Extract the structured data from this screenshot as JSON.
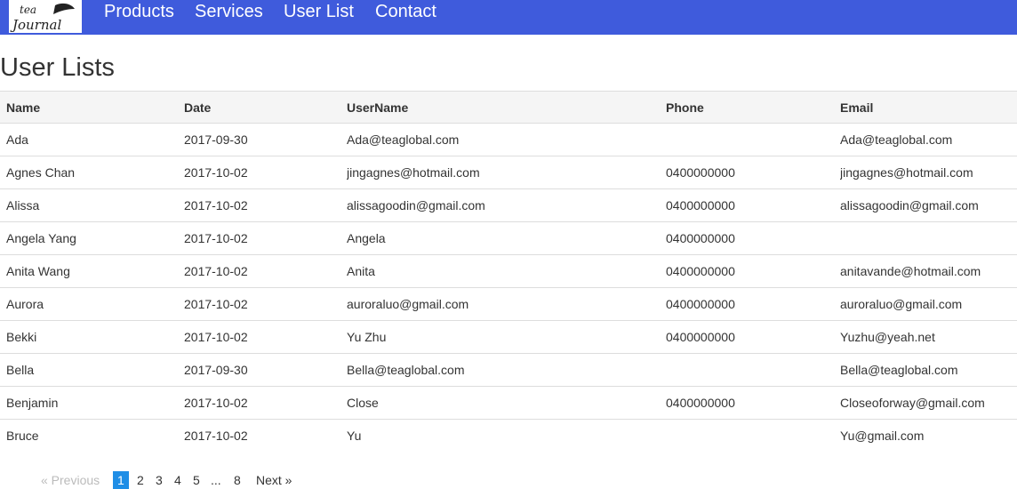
{
  "navbar": {
    "brand": "tea Journal",
    "links": [
      "Products",
      "Services",
      "User List",
      "Contact"
    ]
  },
  "page": {
    "title": "User Lists"
  },
  "table": {
    "headers": [
      "Name",
      "Date",
      "UserName",
      "Phone",
      "Email"
    ],
    "rows": [
      [
        "Ada",
        "2017-09-30",
        "Ada@teaglobal.com",
        "",
        "Ada@teaglobal.com"
      ],
      [
        "Agnes Chan",
        "2017-10-02",
        "jingagnes@hotmail.com",
        "0400000000",
        "jingagnes@hotmail.com"
      ],
      [
        "Alissa",
        "2017-10-02",
        "alissagoodin@gmail.com",
        "0400000000",
        "alissagoodin@gmail.com"
      ],
      [
        "Angela Yang",
        "2017-10-02",
        "Angela",
        "0400000000",
        ""
      ],
      [
        "Anita Wang",
        "2017-10-02",
        "Anita",
        "0400000000",
        "anitavande@hotmail.com"
      ],
      [
        "Aurora",
        "2017-10-02",
        "auroraluo@gmail.com",
        "0400000000",
        "auroraluo@gmail.com"
      ],
      [
        "Bekki",
        "2017-10-02",
        "Yu Zhu",
        "0400000000",
        "Yuzhu@yeah.net"
      ],
      [
        "Bella",
        "2017-09-30",
        "Bella@teaglobal.com",
        "",
        "Bella@teaglobal.com"
      ],
      [
        "Benjamin",
        "2017-10-02",
        "Close",
        "0400000000",
        "Closeoforway@gmail.com"
      ],
      [
        "Bruce",
        "2017-10-02",
        "Yu",
        "",
        "Yu@gmail.com"
      ]
    ]
  },
  "pagination": {
    "previous": "« Previous",
    "pages": [
      "1",
      "2",
      "3",
      "4",
      "5",
      "...",
      "8"
    ],
    "active_page": "1",
    "next": "Next »"
  },
  "colors": {
    "navbar": "#3f5bdc",
    "active_page": "#1f8ee6"
  }
}
